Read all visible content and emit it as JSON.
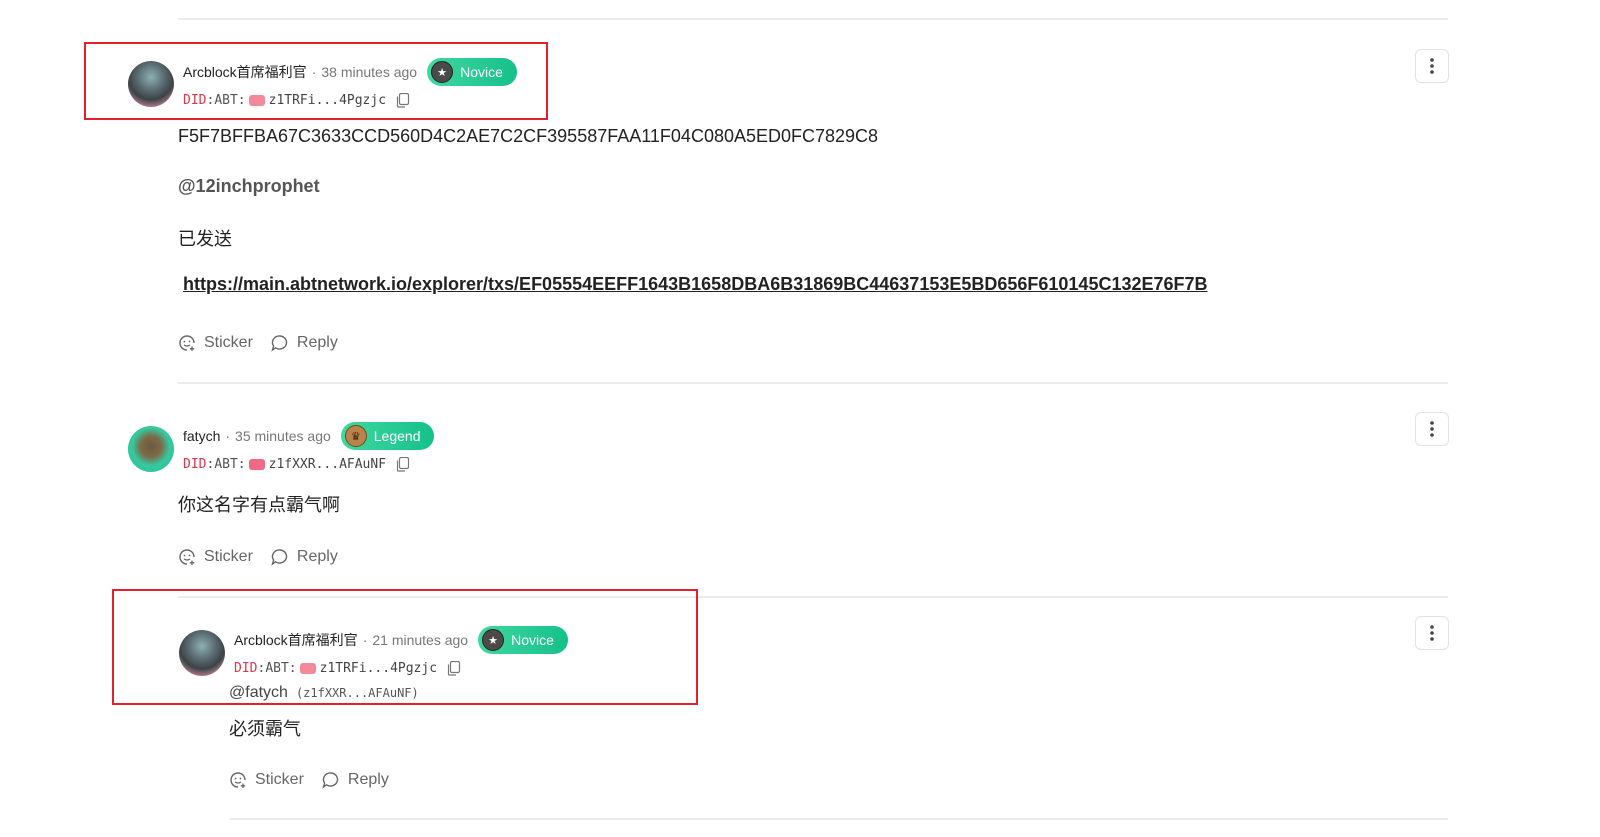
{
  "comments": [
    {
      "name": "Arcblock首席福利官",
      "time": "38 minutes ago",
      "badge": "Novice",
      "did_label": "DID",
      "did_prefix": "ABT:",
      "did_addr": "z1TRFi...4Pgzjc",
      "lines": {
        "hash": "F5F7BFFBA67C3633CCD560D4C2AE7C2CF395587FAA11F04C080A5ED0FC7829C8",
        "mention": "@12inchprophet",
        "text": "已发送",
        "link": "https://main.abtnetwork.io/explorer/txs/EF05554EEFF1643B1658DBA6B31869BC44637153E5BD656F610145C132E76F7B"
      },
      "sticker_label": "Sticker",
      "reply_label": "Reply"
    },
    {
      "name": "fatych",
      "time": "35 minutes ago",
      "badge": "Legend",
      "did_label": "DID",
      "did_prefix": "ABT:",
      "did_addr": "z1fXXR...AFAuNF",
      "text": "你这名字有点霸气啊",
      "sticker_label": "Sticker",
      "reply_label": "Reply"
    },
    {
      "name": "Arcblock首席福利官",
      "time": "21 minutes ago",
      "badge": "Novice",
      "did_label": "DID",
      "did_prefix": "ABT:",
      "did_addr": "z1TRFi...4Pgzjc",
      "reply_to": "@fatych",
      "reply_to_did": "(z1fXXR...AFAuNF)",
      "text": "必须霸气",
      "sticker_label": "Sticker",
      "reply_label": "Reply"
    }
  ],
  "separator": "·",
  "icons": {
    "more": "more-vertical-icon",
    "copy": "copy-icon",
    "sticker": "sticker-icon",
    "reply": "reply-bubble-icon",
    "badge": "badge-medal-icon"
  },
  "colors": {
    "badge_gradient_start": "#3fd8a0",
    "badge_gradient_end": "#16c08a",
    "did_label": "#d9364a",
    "highlight_border": "#e5202e"
  }
}
